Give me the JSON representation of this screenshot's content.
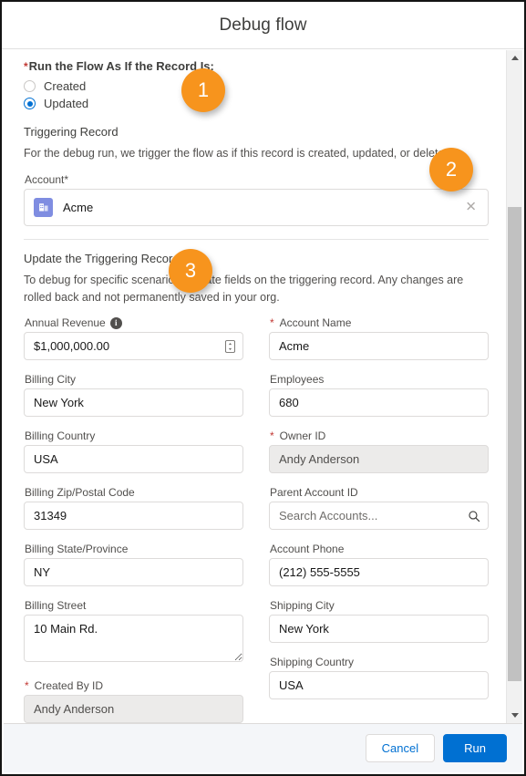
{
  "dialog": {
    "title": "Debug flow"
  },
  "run_as": {
    "label": "Run the Flow As If the Record Is:",
    "required_marker": "*",
    "options": [
      {
        "label": "Created",
        "selected": false
      },
      {
        "label": "Updated",
        "selected": true
      }
    ]
  },
  "triggering_record": {
    "heading": "Triggering Record",
    "description": "For the debug run, we trigger the flow as if this record is created, updated, or deleted.",
    "lookup_label": "Account*",
    "lookup_value": "Acme",
    "lookup_icon": "account-object-icon",
    "clear_icon": "close-icon"
  },
  "update_record": {
    "heading": "Update the Triggering Record",
    "description": "To debug for specific scenarios, update fields on the triggering record. Any changes are rolled back and not permanently saved in your org.",
    "fields_left": [
      {
        "label": "Annual Revenue",
        "value": "$1,000,000.00",
        "placeholder": "",
        "required": false,
        "disabled": false,
        "type": "text",
        "info_icon": "info-icon",
        "trailing_icon": "stepper-icon",
        "name": "annual-revenue"
      },
      {
        "label": "Billing City",
        "value": "New York",
        "placeholder": "",
        "required": false,
        "disabled": false,
        "type": "text",
        "name": "billing-city"
      },
      {
        "label": "Billing Country",
        "value": "USA",
        "placeholder": "",
        "required": false,
        "disabled": false,
        "type": "text",
        "name": "billing-country"
      },
      {
        "label": "Billing Zip/Postal Code",
        "value": "31349",
        "placeholder": "",
        "required": false,
        "disabled": false,
        "type": "text",
        "name": "billing-zip"
      },
      {
        "label": "Billing State/Province",
        "value": "NY",
        "placeholder": "",
        "required": false,
        "disabled": false,
        "type": "text",
        "name": "billing-state"
      },
      {
        "label": "Billing Street",
        "value": "10 Main Rd.",
        "placeholder": "",
        "required": false,
        "disabled": false,
        "type": "textarea",
        "name": "billing-street"
      },
      {
        "label": "Created By ID",
        "value": "Andy Anderson",
        "placeholder": "",
        "required": true,
        "disabled": true,
        "type": "text",
        "name": "created-by-id"
      }
    ],
    "fields_right": [
      {
        "label": "Account Name",
        "value": "Acme",
        "placeholder": "",
        "required": true,
        "disabled": false,
        "type": "text",
        "name": "account-name"
      },
      {
        "label": "Employees",
        "value": "680",
        "placeholder": "",
        "required": false,
        "disabled": false,
        "type": "text",
        "name": "employees"
      },
      {
        "label": "Owner ID",
        "value": "Andy Anderson",
        "placeholder": "",
        "required": true,
        "disabled": true,
        "type": "text",
        "name": "owner-id"
      },
      {
        "label": "Parent Account ID",
        "value": "",
        "placeholder": "Search Accounts...",
        "required": false,
        "disabled": false,
        "type": "text",
        "trailing_icon": "search-icon",
        "name": "parent-account-id"
      },
      {
        "label": "Account Phone",
        "value": "(212) 555-5555",
        "placeholder": "",
        "required": false,
        "disabled": false,
        "type": "text",
        "name": "account-phone"
      },
      {
        "label": "Shipping City",
        "value": "New York",
        "placeholder": "",
        "required": false,
        "disabled": false,
        "type": "text",
        "name": "shipping-city"
      },
      {
        "label": "Shipping Country",
        "value": "USA",
        "placeholder": "",
        "required": false,
        "disabled": false,
        "type": "text",
        "name": "shipping-country"
      }
    ]
  },
  "footer": {
    "cancel_label": "Cancel",
    "run_label": "Run"
  },
  "callouts": [
    {
      "number": "1"
    },
    {
      "number": "2"
    },
    {
      "number": "3"
    }
  ],
  "colors": {
    "brand_blue": "#0070d2",
    "callout_orange": "#f7941d",
    "required_red": "#c23934",
    "account_icon_purple": "#7f8de1"
  }
}
